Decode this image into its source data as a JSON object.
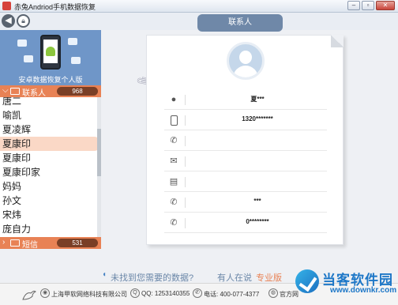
{
  "window": {
    "title": "赤兔Andriod手机数据恢复",
    "buttons": [
      "–",
      "▫",
      "✕"
    ]
  },
  "nav": {
    "back_icon": "back-arrow-icon",
    "lock_icon": "lock-icon",
    "tab_label": "联系人"
  },
  "banner": {
    "label": "安卓数据恢复个人版"
  },
  "contacts_section": {
    "label": "联系人",
    "count": "968"
  },
  "contact_list": [
    "唐二",
    "喻凯",
    "夏凌辉",
    "夏康印",
    "夏康印",
    "夏康印家",
    "妈妈",
    "孙文",
    "宋炜",
    "庞自力"
  ],
  "selected_index": 3,
  "sms_section": {
    "label": "短信",
    "count": "531"
  },
  "detail": {
    "rows": [
      {
        "icon": "person-icon",
        "value": "夏***"
      },
      {
        "icon": "mobile-phone-icon",
        "value": "1320*******"
      },
      {
        "icon": "phone-icon",
        "value": ""
      },
      {
        "icon": "email-icon",
        "value": ""
      },
      {
        "icon": "contact-card-icon",
        "value": ""
      },
      {
        "icon": "phone-extra-icon",
        "value": "***"
      },
      {
        "icon": "phone-extra-icon",
        "value": "0********"
      }
    ]
  },
  "bottom_bar": {
    "hint": "未找到您需要的数据?",
    "hint2": "有人在说",
    "pro": "专业版"
  },
  "footer": {
    "company": "上海甲软网络科技有限公司",
    "qq": "QQ: 1253140355",
    "phone": "电话: 400-077-4377",
    "site": "官方网"
  },
  "watermark": {
    "title": "当客软件园",
    "url": "www.downkr.com"
  }
}
